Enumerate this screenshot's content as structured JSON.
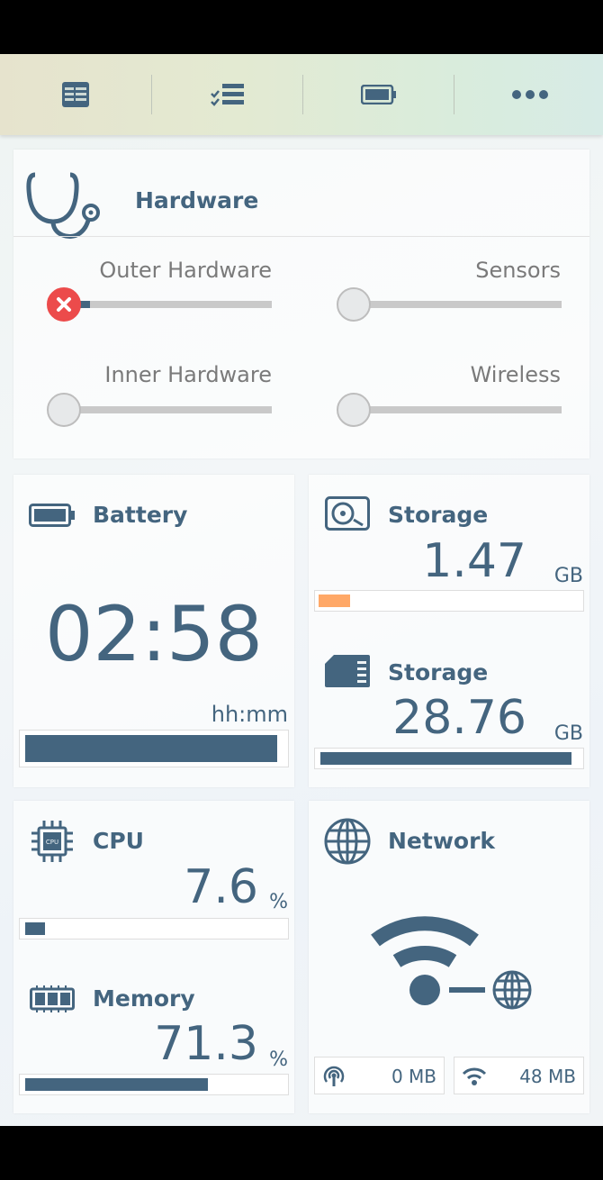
{
  "toolbar": {
    "items": [
      {
        "icon": "table-icon"
      },
      {
        "icon": "checklist-icon"
      },
      {
        "icon": "battery-icon"
      },
      {
        "icon": "more-dots-icon"
      }
    ]
  },
  "hardware": {
    "title": "Hardware",
    "icon": "stethoscope-icon",
    "sliders": {
      "outer": {
        "label": "Outer Hardware",
        "level": 0.13,
        "status": "error"
      },
      "sensors": {
        "label": "Sensors",
        "level": 0.0
      },
      "inner": {
        "label": "Inner Hardware",
        "level": 0.0
      },
      "wireless": {
        "label": "Wireless",
        "level": 0.0
      }
    }
  },
  "battery": {
    "title": "Battery",
    "time": "02:58",
    "unit": "hh:mm",
    "level": 0.98
  },
  "storage_internal": {
    "title": "Storage",
    "value": "1.47",
    "unit": "GB",
    "level": 0.06,
    "bar_color": "#ffa867"
  },
  "storage_sd": {
    "title": "Storage",
    "value": "28.76",
    "unit": "GB",
    "level": 0.98
  },
  "cpu": {
    "title": "CPU",
    "value": "7.6",
    "unit": "%",
    "level": 0.076
  },
  "memory": {
    "title": "Memory",
    "value": "71.3",
    "unit": "%",
    "level": 0.713
  },
  "network": {
    "title": "Network",
    "mobile": "0 MB",
    "wifi": "48 MB"
  },
  "colors": {
    "accent": "#44657f",
    "error": "#ec4b4b",
    "storage_orange": "#ffa867"
  }
}
